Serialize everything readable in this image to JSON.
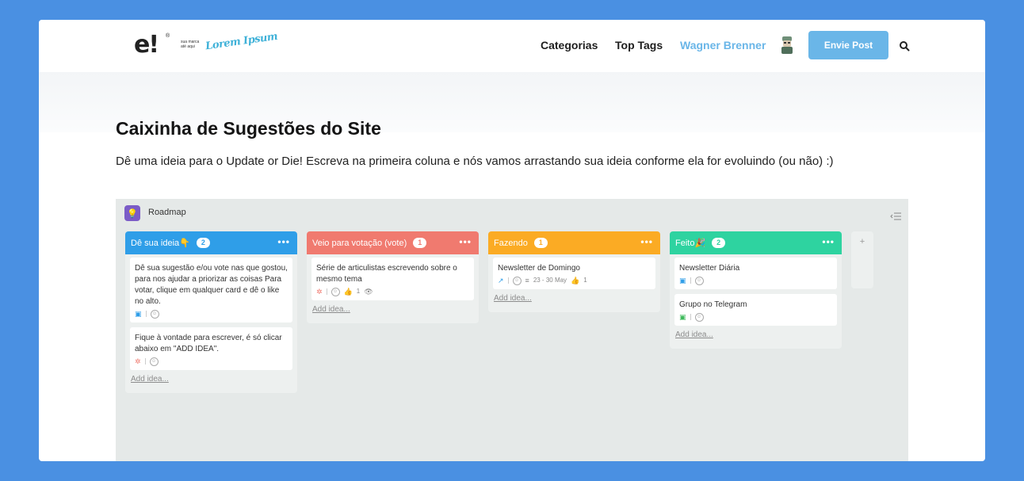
{
  "header": {
    "logo_text": "e!",
    "sponsor_small": "sua marca\naté aqui",
    "sponsor_script": "Lorem Ipsum",
    "nav": [
      {
        "label": "Categorias"
      },
      {
        "label": "Top Tags"
      },
      {
        "label": "Wagner Brenner"
      }
    ],
    "cta_label": "Envie Post"
  },
  "page": {
    "title": "Caixinha de Sugestões do Site",
    "description": "Dê uma ideia para o Update or Die! Escreva na primeira coluna e nós vamos arrastando sua ideia conforme ela for evoluindo (ou não) :)"
  },
  "board": {
    "title": "Roadmap",
    "add_idea_label": "Add idea...",
    "add_column_label": "+",
    "columns": [
      {
        "name": "Dê sua ideia👇",
        "count": "2",
        "color": "#2f9ee8",
        "cards": [
          {
            "text": "Dê sua sugestão e/ou vote nas que gostou, para nos ajudar a priorizar as coisas Para votar, clique em qualquer card e dê o like no alto."
          },
          {
            "text": "Fique à vontade para escrever, é só clicar abaixo em \"ADD IDEA\"."
          }
        ]
      },
      {
        "name": "Veio para votação (vote)",
        "count": "1",
        "color": "#f07a6f",
        "cards": [
          {
            "text": "Série de articulistas escrevendo sobre o mesmo tema",
            "likes": "1"
          }
        ]
      },
      {
        "name": "Fazendo",
        "count": "1",
        "color": "#fbab24",
        "cards": [
          {
            "text": "Newsletter de Domingo",
            "date": "23 - 30 May",
            "likes": "1"
          }
        ]
      },
      {
        "name": "Feito🎉",
        "count": "2",
        "color": "#2ed3a0",
        "cards": [
          {
            "text": "Newsletter Diária"
          },
          {
            "text": "Grupo no Telegram"
          }
        ]
      }
    ]
  }
}
